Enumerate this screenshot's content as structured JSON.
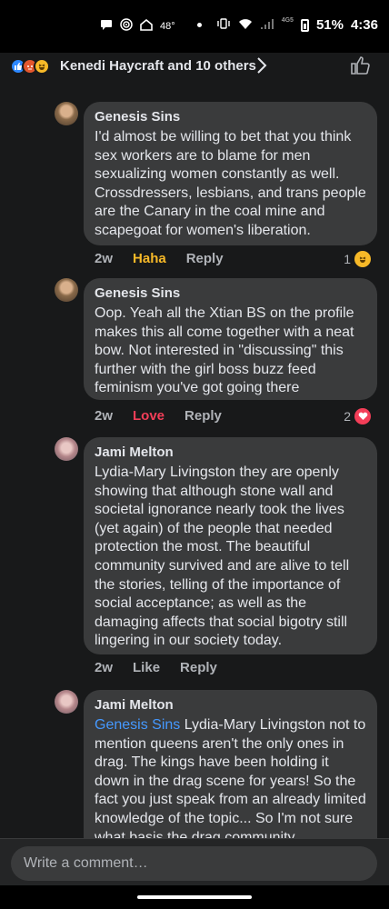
{
  "status_bar": {
    "temperature": "48°",
    "network": "4G5",
    "battery": "51%",
    "time": "4:36"
  },
  "header": {
    "reactions": [
      "like",
      "angry",
      "haha"
    ],
    "names": "Kenedi Haycraft and 10 others"
  },
  "comments": [
    {
      "author": "Genesis Sins",
      "text": "I'd almost be willing to bet that you think sex workers are to blame for men sexualizing women constantly as well. Crossdressers, lesbians, and trans people are the Canary in the coal mine and scapegoat for women's liberation.",
      "time": "2w",
      "reaction_label": "Haha",
      "reply": "Reply",
      "count": "1",
      "count_emoji": "haha"
    },
    {
      "author": "Genesis Sins",
      "text": "Oop. Yeah all the Xtian BS on the profile makes this all come together with a neat bow. Not interested in \"discussing\" this further with the girl boss buzz feed feminism you've got going there",
      "time": "2w",
      "reaction_label": "Love",
      "reply": "Reply",
      "count": "2",
      "count_emoji": "love"
    },
    {
      "author": "Jami Melton",
      "text": "Lydia-Mary Livingston they are openly showing that although stone wall and societal ignorance nearly took the lives (yet again) of the people that needed protection the most. The beautiful community survived and are alive to tell the stories, telling of the importance of social acceptance; as well as the damaging affects that social bigotry still lingering in our society today.",
      "time": "2w",
      "reaction_label": "Like",
      "reply": "Reply"
    },
    {
      "author": "Jami Melton",
      "mention": "Genesis Sins",
      "text": " Lydia-Mary Livingston not to mention queens aren't the only ones in drag. The kings have been holding it down in the drag scene for years! So the fact you just speak from an already limited knowledge of the topic... So I'm not sure what basis the drag community"
    }
  ],
  "composer": {
    "placeholder": "Write a comment…"
  }
}
